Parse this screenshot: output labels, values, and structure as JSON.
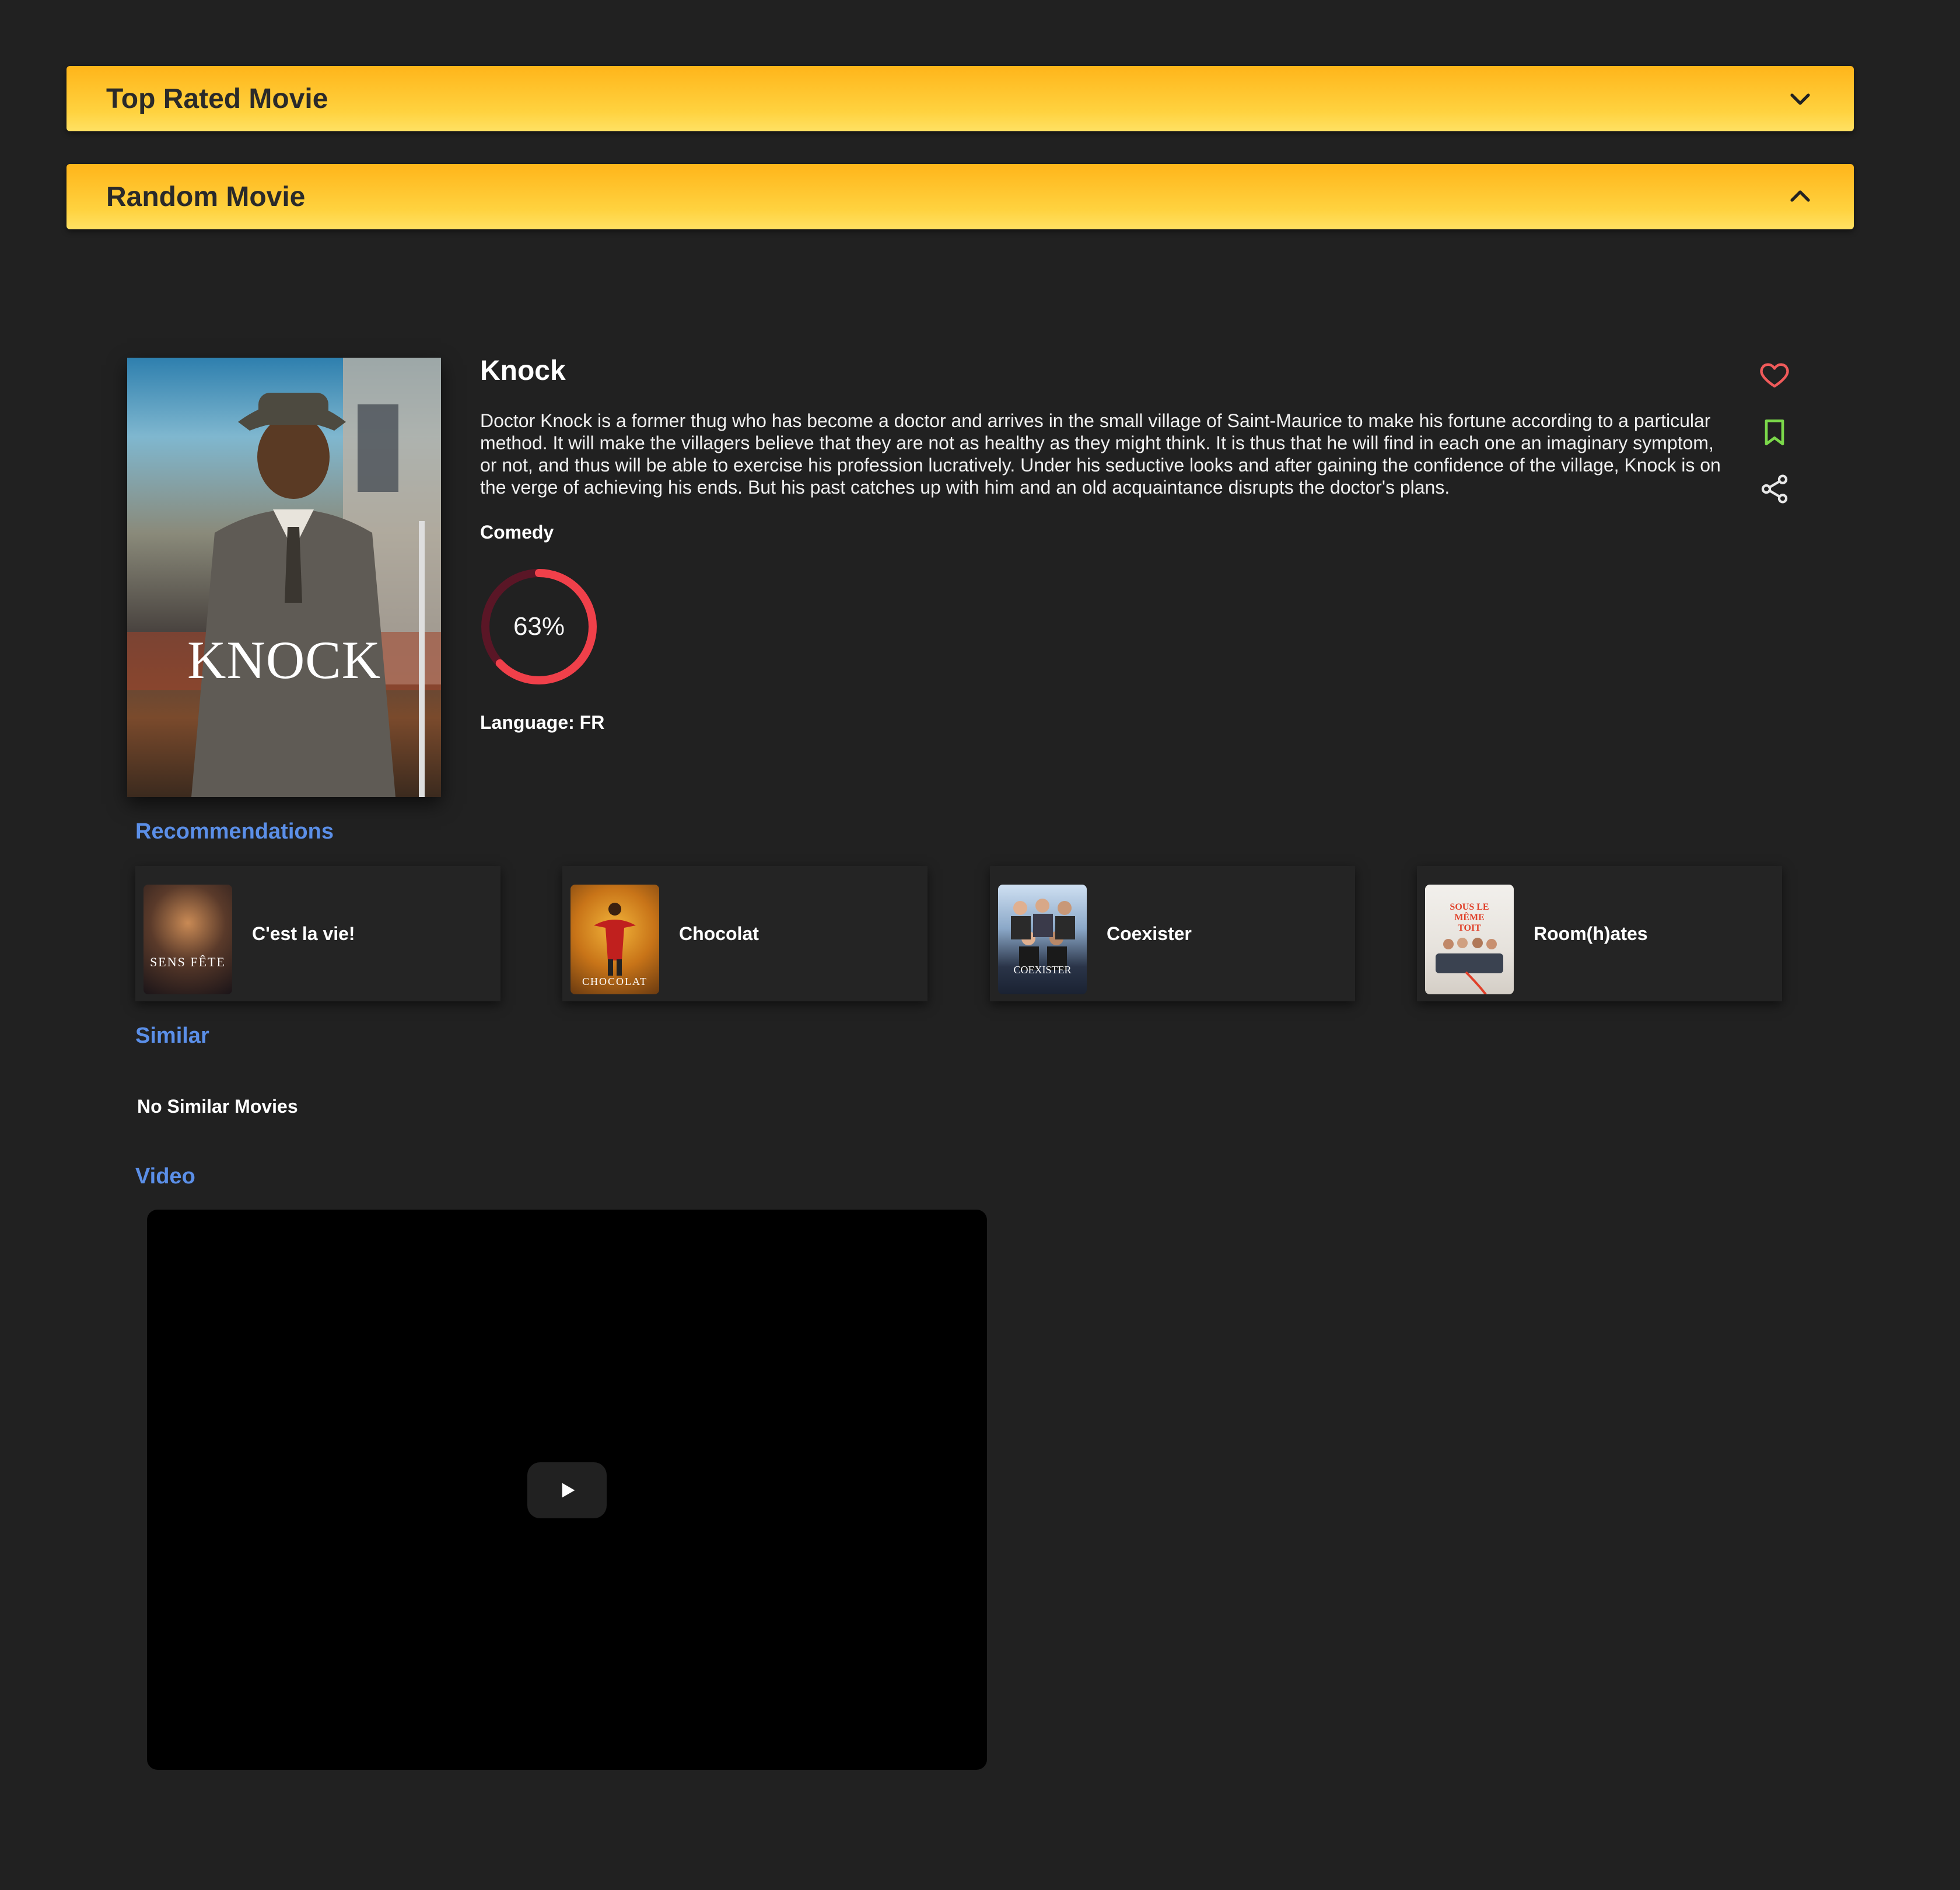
{
  "accordions": {
    "top_rated": {
      "title": "Top Rated Movie",
      "icon": "chevron-down-icon",
      "expanded": false
    },
    "random": {
      "title": "Random Movie",
      "icon": "chevron-up-icon",
      "expanded": true
    }
  },
  "movie": {
    "title": "Knock",
    "poster_title": "KNOCK",
    "overview": "Doctor Knock is a former thug who has become a doctor and arrives in the small village of Saint-Maurice to make his fortune according to a particular method. It will make the villagers believe that they are not as healthy as they might think. It is thus that he will find in each one an imaginary symptom, or not, and thus will be able to exercise his profession lucratively. Under his seductive looks and after gaining the confidence of the village, Knock is on the verge of achieving his ends. But his past catches up with him and an old acquaintance disrupts the doctor's plans.",
    "genre": "Comedy",
    "rating_percent": 63,
    "rating_text": "63%",
    "language": "Language: FR"
  },
  "actions": {
    "favorite": {
      "icon": "heart-icon",
      "color": "#f05a5a"
    },
    "watchlist": {
      "icon": "bookmark-icon",
      "color": "#7bd84a"
    },
    "share": {
      "icon": "share-icon",
      "color": "#e8e8e8"
    }
  },
  "sections": {
    "recommendations": "Recommendations",
    "similar": "Similar",
    "video": "Video"
  },
  "recommendations": [
    {
      "title": "C'est la vie!",
      "poster_text": "SENS FÊTE"
    },
    {
      "title": "Chocolat",
      "poster_text": "CHOCOLAT"
    },
    {
      "title": "Coexister",
      "poster_text": "COEXISTER"
    },
    {
      "title": "Room(h)ates",
      "poster_text": "SOUS LE MÊME TOIT"
    }
  ],
  "similar": {
    "empty_text": "No Similar Movies"
  },
  "video": {
    "play_icon": "play-icon"
  },
  "colors": {
    "background": "#212121",
    "accent_yellow": "#ffc526",
    "section_heading": "#5b8fe8",
    "rating_ring": "#f0404a"
  }
}
